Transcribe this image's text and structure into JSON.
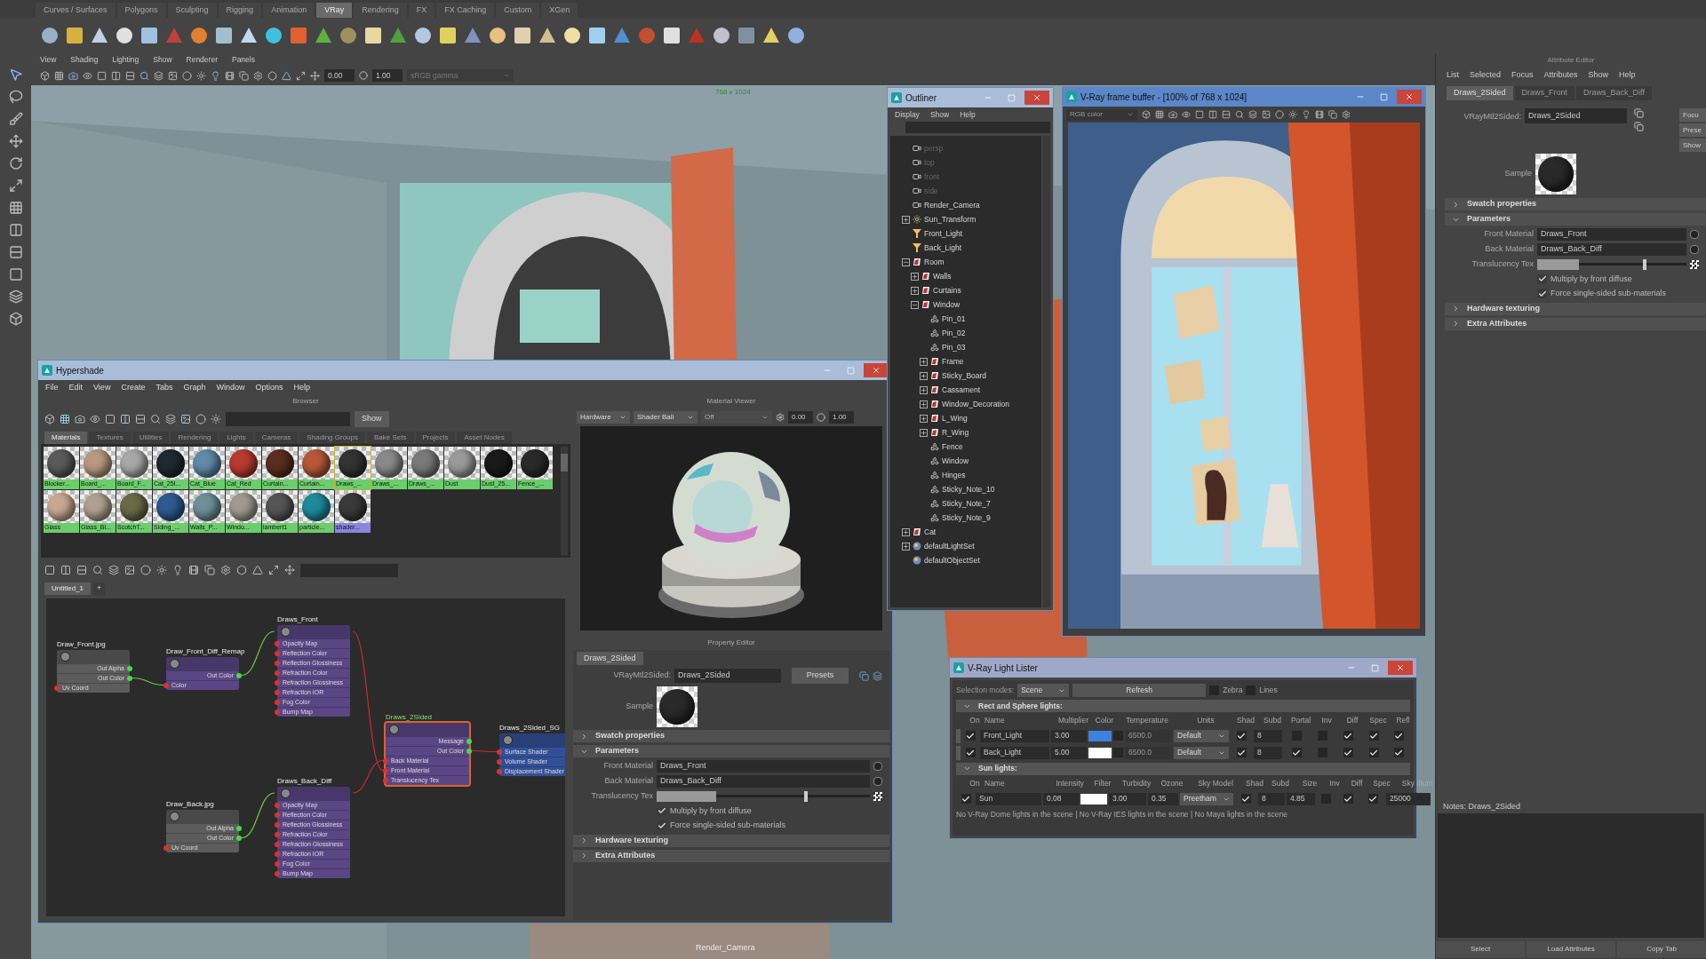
{
  "shelf_tabs": [
    {
      "label": "Curves / Surfaces",
      "selected": false
    },
    {
      "label": "Polygons",
      "selected": false
    },
    {
      "label": "Sculpting",
      "selected": false
    },
    {
      "label": "Rigging",
      "selected": false
    },
    {
      "label": "Animation",
      "selected": false
    },
    {
      "label": "VRay",
      "selected": true
    },
    {
      "label": "Rendering",
      "selected": false
    },
    {
      "label": "FX",
      "selected": false
    },
    {
      "label": "FX Caching",
      "selected": false
    },
    {
      "label": "Custom",
      "selected": false
    },
    {
      "label": "XGen",
      "selected": false
    }
  ],
  "viewport": {
    "menu": [
      "View",
      "Shading",
      "Lighting",
      "Show",
      "Renderer",
      "Panels"
    ],
    "exposure": "0.00",
    "gamma": "1.00",
    "color_space": "sRGB gamma",
    "resolution": "768 x 1024",
    "camera": "Render_Camera"
  },
  "hypershade": {
    "title": "Hypershade",
    "menu": [
      "File",
      "Edit",
      "View",
      "Create",
      "Tabs",
      "Graph",
      "Window",
      "Options",
      "Help"
    ],
    "browser": {
      "title": "Browser",
      "show_button": "Show",
      "tabs": [
        {
          "label": "Materials",
          "selected": true
        },
        {
          "label": "Textures",
          "selected": false
        },
        {
          "label": "Utilities",
          "selected": false
        },
        {
          "label": "Rendering",
          "selected": false
        },
        {
          "label": "Lights",
          "selected": false
        },
        {
          "label": "Cameras",
          "selected": false
        },
        {
          "label": "Shading Groups",
          "selected": false
        },
        {
          "label": "Bake Sets",
          "selected": false
        },
        {
          "label": "Projects",
          "selected": false
        },
        {
          "label": "Asset Nodes",
          "selected": false
        }
      ],
      "swatches": [
        {
          "label": "Blocker...",
          "color": "#5a5a5a",
          "kind": "material",
          "selected": false
        },
        {
          "label": "Board_...",
          "color": "#b89a80",
          "kind": "material",
          "selected": false
        },
        {
          "label": "Board_F...",
          "color": "#a8a8a8",
          "kind": "material",
          "selected": false
        },
        {
          "label": "Cat_25I...",
          "color": "#1e2a30",
          "kind": "material",
          "selected": false
        },
        {
          "label": "Cat_Blue",
          "color": "#5f8aa8",
          "kind": "material",
          "selected": false
        },
        {
          "label": "Cat_Red",
          "color": "#b83a30",
          "kind": "material",
          "selected": false
        },
        {
          "label": "Curtain...",
          "color": "#5a2e1e",
          "kind": "material",
          "selected": false
        },
        {
          "label": "Curtain...",
          "color": "#b8583a",
          "kind": "material",
          "selected": false
        },
        {
          "label": "Draws_...",
          "color": "#333333",
          "kind": "material",
          "selected": true
        },
        {
          "label": "Draws_...",
          "color": "#8a8a8a",
          "kind": "material",
          "selected": false
        },
        {
          "label": "Draws_...",
          "color": "#7a7a7a",
          "kind": "material",
          "selected": false
        },
        {
          "label": "Dust",
          "color": "#9a9a9a",
          "kind": "material",
          "selected": false
        },
        {
          "label": "Dust_25...",
          "color": "#1a1a1a",
          "kind": "material",
          "selected": false
        },
        {
          "label": "Fence_...",
          "color": "#2a2a2a",
          "kind": "material",
          "selected": false
        },
        {
          "label": "Glass",
          "color": "#c8a890",
          "kind": "material",
          "selected": false
        },
        {
          "label": "Glass_Bl...",
          "color": "#b0a090",
          "kind": "material",
          "selected": false
        },
        {
          "label": "ScotchT...",
          "color": "#6a6a48",
          "kind": "material",
          "selected": false
        },
        {
          "label": "Siding_...",
          "color": "#2e5a90",
          "kind": "material",
          "selected": false
        },
        {
          "label": "Walls_P...",
          "color": "#6e9098",
          "kind": "material",
          "selected": false
        },
        {
          "label": "Windo...",
          "color": "#a09a90",
          "kind": "material",
          "selected": false
        },
        {
          "label": "lambert1",
          "color": "#555555",
          "kind": "material",
          "selected": false
        },
        {
          "label": "particle...",
          "color": "#1e8a9a",
          "kind": "material",
          "selected": false
        },
        {
          "label": "shader...",
          "color": "#3a3a3a",
          "kind": "shader",
          "selected": false
        }
      ]
    },
    "graph_tabs": [
      {
        "label": "Untitled_1",
        "selected": true
      }
    ],
    "add_tab": "+",
    "nodes": [
      {
        "title": "Draw_Front.jpg",
        "kind": "texture",
        "selected": false,
        "ports": [
          {
            "label": "Out Alpha",
            "kind": "out"
          },
          {
            "label": "Out Color",
            "kind": "out"
          },
          {
            "label": "Uv Coord",
            "kind": "in"
          }
        ]
      },
      {
        "title": "Draw_Front_Diff_Remap",
        "kind": "utility",
        "selected": false,
        "ports": [
          {
            "label": "Out Color",
            "kind": "out"
          },
          {
            "label": "Color",
            "kind": "in"
          }
        ]
      },
      {
        "title": "Draws_Front",
        "kind": "material",
        "selected": false,
        "ports": [
          {
            "label": "Opacity Map",
            "kind": "in"
          },
          {
            "label": "Reflection Color",
            "kind": "in"
          },
          {
            "label": "Reflection Glossiness",
            "kind": "in"
          },
          {
            "label": "Refraction Color",
            "kind": "in"
          },
          {
            "label": "Refraction Glossiness",
            "kind": "in"
          },
          {
            "label": "Refraction IOR",
            "kind": "in"
          },
          {
            "label": "Fog Color",
            "kind": "in"
          },
          {
            "label": "Bump Map",
            "kind": "in"
          }
        ]
      },
      {
        "title": "Draws_2Sided",
        "kind": "material",
        "selected": true,
        "ports": [
          {
            "label": "Message",
            "kind": "out"
          },
          {
            "label": "Out Color",
            "kind": "out"
          },
          {
            "label": "Back Material",
            "kind": "in"
          },
          {
            "label": "Front Material",
            "kind": "in"
          },
          {
            "label": "Translucency Tex",
            "kind": "in"
          }
        ]
      },
      {
        "title": "Draws_2Sided_SG",
        "kind": "shading_group",
        "selected": false,
        "ports": [
          {
            "label": "Surface Shader",
            "kind": "in"
          },
          {
            "label": "Volume Shader",
            "kind": "in"
          },
          {
            "label": "Displacement Shader",
            "kind": "in"
          }
        ]
      },
      {
        "title": "Draw_Back.jpg",
        "kind": "texture",
        "selected": false,
        "ports": [
          {
            "label": "Out Alpha",
            "kind": "out"
          },
          {
            "label": "Out Color",
            "kind": "out"
          },
          {
            "label": "Uv Coord",
            "kind": "in"
          }
        ]
      },
      {
        "title": "Draws_Back_Diff",
        "kind": "material",
        "selected": false,
        "ports": [
          {
            "label": "Opacity Map",
            "kind": "in"
          },
          {
            "label": "Reflection Color",
            "kind": "in"
          },
          {
            "label": "Reflection Glossiness",
            "kind": "in"
          },
          {
            "label": "Refraction Color",
            "kind": "in"
          },
          {
            "label": "Refraction Glossiness",
            "kind": "in"
          },
          {
            "label": "Refraction IOR",
            "kind": "in"
          },
          {
            "label": "Fog Color",
            "kind": "in"
          },
          {
            "label": "Bump Map",
            "kind": "in"
          }
        ]
      }
    ],
    "material_viewer": {
      "title": "Material Viewer",
      "renderer": "Hardware",
      "shape": "Shader Ball",
      "mode": "Off",
      "exposure": "0.00",
      "gamma": "1.00"
    },
    "property_editor": {
      "title": "Property Editor",
      "tab": "Draws_2Sided",
      "type_label": "VRayMtl2Sided:",
      "name_field": "Draws_2Sided",
      "buttons": [
        "Presets"
      ],
      "sample_label": "Sample",
      "sections": [
        {
          "label": "Swatch properties",
          "expanded": false
        },
        {
          "label": "Parameters",
          "expanded": true,
          "fields": [
            {
              "kind": "text",
              "label": "Front Material",
              "value": "Draws_Front"
            },
            {
              "kind": "text",
              "label": "Back Material",
              "value": "Draws_Back_Diff"
            },
            {
              "kind": "slider",
              "label": "Translucency Tex",
              "level": 0.7
            },
            {
              "kind": "checkbox",
              "label": "Multiply by front diffuse",
              "checked": true
            },
            {
              "kind": "checkbox",
              "label": "Force single-sided sub-materials",
              "checked": true
            }
          ]
        },
        {
          "label": "Hardware texturing",
          "expanded": false
        },
        {
          "label": "Extra Attributes",
          "expanded": false
        }
      ]
    }
  },
  "outliner": {
    "title": "Outliner",
    "menu": [
      "Display",
      "Show",
      "Help"
    ],
    "items": [
      {
        "label": "persp",
        "kind": "camera",
        "hidden": true
      },
      {
        "label": "top",
        "kind": "camera",
        "hidden": true
      },
      {
        "label": "front",
        "kind": "camera",
        "hidden": true
      },
      {
        "label": "side",
        "kind": "camera",
        "hidden": true
      },
      {
        "label": "Render_Camera",
        "kind": "camera",
        "hidden": false
      },
      {
        "label": "Sun_Transform",
        "kind": "sun",
        "hidden": false,
        "expanded": false
      },
      {
        "label": "Front_Light",
        "kind": "spotlight",
        "hidden": false
      },
      {
        "label": "Back_Light",
        "kind": "spotlight",
        "hidden": false
      },
      {
        "label": "Room",
        "kind": "group",
        "hidden": false,
        "expanded": true,
        "children": [
          {
            "label": "Walls",
            "kind": "group",
            "hidden": false,
            "expanded": false
          },
          {
            "label": "Curtains",
            "kind": "group",
            "hidden": false,
            "expanded": false
          },
          {
            "label": "Window",
            "kind": "group",
            "hidden": false,
            "expanded": true,
            "children": [
              {
                "label": "Pin_01",
                "kind": "mesh",
                "hidden": false
              },
              {
                "label": "Pin_02",
                "kind": "mesh",
                "hidden": false
              },
              {
                "label": "Pin_03",
                "kind": "mesh",
                "hidden": false
              },
              {
                "label": "Frame",
                "kind": "group",
                "hidden": false,
                "expanded": false
              },
              {
                "label": "Sticky_Board",
                "kind": "group",
                "hidden": false,
                "expanded": false
              },
              {
                "label": "Cassament",
                "kind": "group",
                "hidden": false,
                "expanded": false
              },
              {
                "label": "Window_Decoration",
                "kind": "group",
                "hidden": false,
                "expanded": false
              },
              {
                "label": "L_Wing",
                "kind": "group",
                "hidden": false,
                "expanded": false
              },
              {
                "label": "R_Wing",
                "kind": "group",
                "hidden": false,
                "expanded": false
              },
              {
                "label": "Fence",
                "kind": "mesh",
                "hidden": false
              },
              {
                "label": "Window",
                "kind": "mesh",
                "hidden": false
              },
              {
                "label": "Hinges",
                "kind": "mesh",
                "hidden": false
              },
              {
                "label": "Sticky_Note_10",
                "kind": "mesh",
                "hidden": false
              },
              {
                "label": "Sticky_Note_7",
                "kind": "mesh",
                "hidden": false
              },
              {
                "label": "Sticky_Note_9",
                "kind": "mesh",
                "hidden": false
              }
            ]
          }
        ]
      },
      {
        "label": "Cat",
        "kind": "group",
        "hidden": false,
        "expanded": false
      },
      {
        "label": "defaultLightSet",
        "kind": "set",
        "hidden": false,
        "expanded": false
      },
      {
        "label": "defaultObjectSet",
        "kind": "set",
        "hidden": false
      }
    ]
  },
  "frame_buffer": {
    "title": "V-Ray frame buffer - [100% of 768 x 1024]",
    "channel": "RGB color"
  },
  "light_lister": {
    "title": "V-Ray Light Lister",
    "selection_label": "Selection modes:",
    "selection_mode": "Scene",
    "refresh": "Refresh",
    "zebra": {
      "label": "Zebra",
      "checked": false
    },
    "lines": {
      "label": "Lines",
      "checked": false
    },
    "rect_section": {
      "label": "Rect and Sphere lights:",
      "expanded": true,
      "columns": [
        "On",
        "Name",
        "Multiplier",
        "Color",
        "Temperature",
        "Units",
        "Shad",
        "Subd",
        "Portal",
        "Inv",
        "Diff",
        "Spec",
        "Refl"
      ],
      "rows": [
        {
          "on": true,
          "name": "Front_Light",
          "multiplier": "3.00",
          "color": "#3d82e0",
          "temp_on": false,
          "temperature": "6500.0",
          "units": "Default",
          "shad": true,
          "subd": "8",
          "portal": false,
          "inv": false,
          "diff": true,
          "spec": true,
          "refl": true
        },
        {
          "on": true,
          "name": "Back_Light",
          "multiplier": "5.00",
          "color": "#ffffff",
          "temp_on": false,
          "temperature": "6500.0",
          "units": "Default",
          "shad": true,
          "subd": "8",
          "portal": true,
          "inv": false,
          "diff": true,
          "spec": true,
          "refl": true
        }
      ]
    },
    "sun_section": {
      "label": "Sun lights:",
      "expanded": true,
      "columns": [
        "On",
        "Name",
        "Intensity",
        "Filter",
        "Turbidity",
        "Ozone",
        "Sky Model",
        "Shad",
        "Subd",
        "Size",
        "Inv",
        "Diff",
        "Spec",
        "Sky Illum"
      ],
      "rows": [
        {
          "on": true,
          "name": "Sun",
          "intensity": "0.08",
          "color": "#ffffff",
          "turbidity": "3.00",
          "ozone": "0.35",
          "sky_model": "Preetham",
          "shad": true,
          "subd": "8",
          "size": "4.85",
          "inv": false,
          "diff": true,
          "spec": true,
          "sky_illum": "25000"
        }
      ]
    },
    "footer": "No V-Ray Dome lights in the scene | No V-Ray IES lights in the scene | No Maya lights in the scene"
  },
  "attribute_editor": {
    "title": "Attribute Editor",
    "menu": [
      "List",
      "Selected",
      "Focus",
      "Attributes",
      "Show",
      "Help"
    ],
    "tabs": [
      {
        "label": "Draws_2Sided",
        "selected": true
      },
      {
        "label": "Draws_Front",
        "selected": false
      },
      {
        "label": "Draws_Back_Diff",
        "selected": false
      }
    ],
    "type_label": "VRayMtl2Sided:",
    "name_field": "Draws_2Sided",
    "buttons": [
      "Focu",
      "Prese",
      "Show"
    ],
    "sample_label": "Sample",
    "sections": [
      {
        "label": "Swatch properties",
        "expanded": false
      },
      {
        "label": "Parameters",
        "expanded": true,
        "fields": [
          {
            "kind": "text",
            "label": "Front Material",
            "value": "Draws_Front"
          },
          {
            "kind": "text",
            "label": "Back Material",
            "value": "Draws_Back_Diff"
          },
          {
            "kind": "slider",
            "label": "Translucency Tex",
            "level": 0.72
          },
          {
            "kind": "checkbox",
            "label": "Multiply by front diffuse",
            "checked": true
          },
          {
            "kind": "checkbox",
            "label": "Force single-sided sub-materials",
            "checked": true
          }
        ]
      },
      {
        "label": "Hardware texturing",
        "expanded": false
      },
      {
        "label": "Extra Attributes",
        "expanded": false
      }
    ],
    "notes_label": "Notes: Draws_2Sided",
    "bottom_buttons": [
      "Select",
      "Load Attributes",
      "Copy Tab"
    ]
  }
}
